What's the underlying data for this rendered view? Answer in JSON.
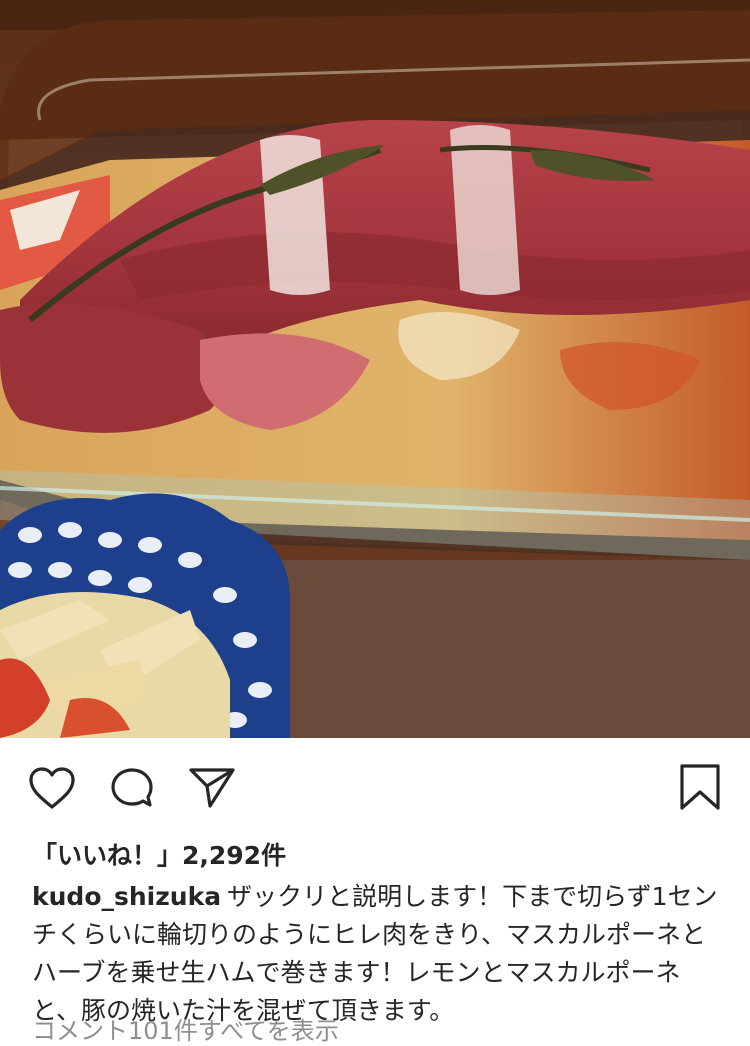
{
  "post": {
    "likes_text": "「いいね！」2,292件",
    "username": "kudo_shizuka",
    "caption": "ザックリと説明します！下まで切らず1センチくらいに輪切りのようにヒレ肉をきり、マスカルポーネとハーブを乗せ生ハムで巻きます！レモンとマスカルポーネと、豚の焼いた汁を混ぜて頂きます。",
    "view_comments": "コメント101件すべてを表示"
  },
  "icons": {
    "like": "heart-icon",
    "comment": "speech-bubble-icon",
    "share": "paper-plane-icon",
    "save": "bookmark-icon"
  },
  "colors": {
    "text": "#262626",
    "muted": "#8e8e8e"
  }
}
